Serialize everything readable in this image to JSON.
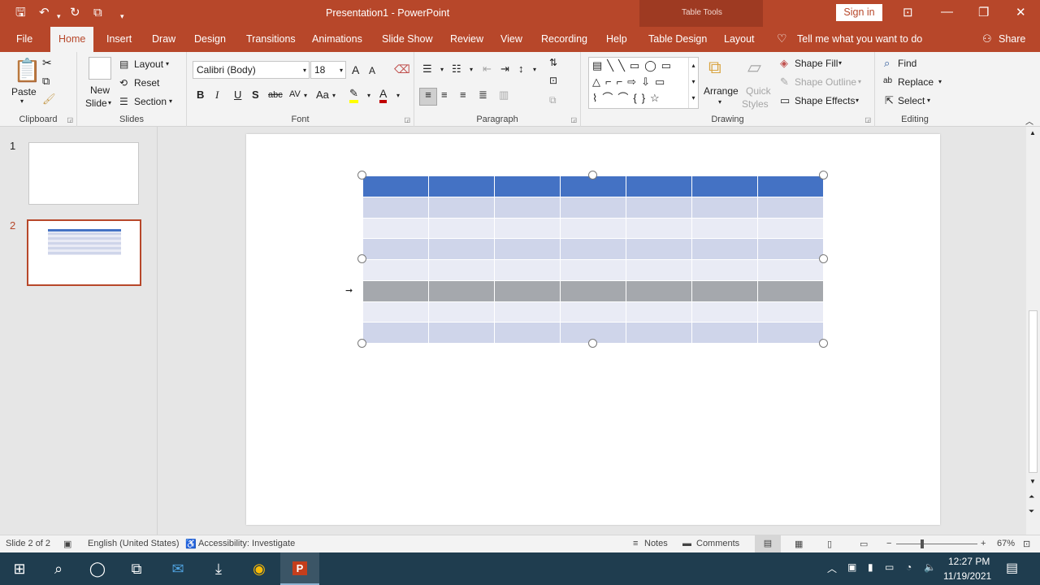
{
  "titlebar": {
    "title": "Presentation1  -  PowerPoint",
    "context_group": "Table Tools",
    "sign_in": "Sign in"
  },
  "tabs": [
    {
      "label": "File"
    },
    {
      "label": "Home"
    },
    {
      "label": "Insert"
    },
    {
      "label": "Draw"
    },
    {
      "label": "Design"
    },
    {
      "label": "Transitions"
    },
    {
      "label": "Animations"
    },
    {
      "label": "Slide Show"
    },
    {
      "label": "Review"
    },
    {
      "label": "View"
    },
    {
      "label": "Recording"
    },
    {
      "label": "Help"
    },
    {
      "label": "Table Design"
    },
    {
      "label": "Layout"
    }
  ],
  "tell_me": "Tell me what you want to do",
  "share": "Share",
  "ribbon": {
    "clipboard": {
      "paste": "Paste",
      "label": "Clipboard"
    },
    "slides": {
      "new": "New",
      "slide": "Slide",
      "layout": "Layout",
      "reset": "Reset",
      "section": "Section",
      "label": "Slides"
    },
    "font": {
      "family": "Calibri (Body)",
      "size": "18",
      "label": "Font",
      "bold": "B",
      "italic": "I",
      "underline": "U",
      "shadow": "S",
      "strike": "abc",
      "spacing": "AV",
      "case": "Aa",
      "grow": "A",
      "shrink": "A"
    },
    "paragraph": {
      "label": "Paragraph"
    },
    "drawing": {
      "arrange": "Arrange",
      "quick": "Quick",
      "styles": "Styles",
      "fill": "Shape Fill",
      "outline": "Shape Outline",
      "effects": "Shape Effects",
      "label": "Drawing"
    },
    "editing": {
      "find": "Find",
      "replace": "Replace",
      "select": "Select",
      "label": "Editing"
    }
  },
  "thumbnails": [
    {
      "number": "1"
    },
    {
      "number": "2"
    }
  ],
  "table": {
    "header_color": "#4472c4",
    "band_dark": "#cfd5ea",
    "band_light": "#e9ebf5",
    "selected_row_color": "#a5a8ad",
    "columns": 7,
    "rows": 8,
    "selected_row": 5
  },
  "status": {
    "slide": "Slide 2 of 2",
    "language": "English (United States)",
    "accessibility": "Accessibility: Investigate",
    "notes": "Notes",
    "comments": "Comments",
    "zoom": "67%"
  },
  "taskbar": {
    "time": "12:27 PM",
    "date": "11/19/2021"
  },
  "colors": {
    "accent": "#b7472a",
    "taskbar": "#1f3d4f"
  }
}
